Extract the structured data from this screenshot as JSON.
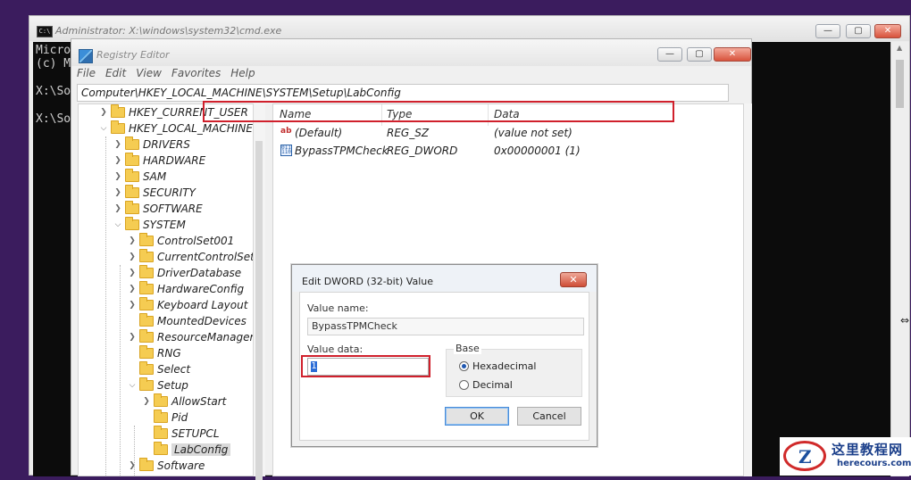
{
  "cmd": {
    "title": "Administrator: X:\\windows\\system32\\cmd.exe",
    "icon_text": "C:\\",
    "lines": [
      "Micro",
      "(c) M",
      "X:\\So",
      "X:\\So"
    ]
  },
  "regedit": {
    "title": "Registry Editor",
    "menu": [
      "File",
      "Edit",
      "View",
      "Favorites",
      "Help"
    ],
    "address": "Computer\\HKEY_LOCAL_MACHINE\\SYSTEM\\Setup\\LabConfig",
    "tree": {
      "hkcu": "HKEY_CURRENT_USER",
      "hklm": "HKEY_LOCAL_MACHINE",
      "drivers": "DRIVERS",
      "hardware": "HARDWARE",
      "sam": "SAM",
      "security": "SECURITY",
      "software": "SOFTWARE",
      "system": "SYSTEM",
      "controlset001": "ControlSet001",
      "currentcontrolset": "CurrentControlSet",
      "driverdatabase": "DriverDatabase",
      "hardwareconfig": "HardwareConfig",
      "keyboardlayout": "Keyboard Layout",
      "mounteddevices": "MountedDevices",
      "resourcemanager": "ResourceManager",
      "rng": "RNG",
      "select": "Select",
      "setup": "Setup",
      "allowstart": "AllowStart",
      "pid": "Pid",
      "setupcl": "SETUPCL",
      "labconfig": "LabConfig",
      "software2": "Software"
    },
    "list": {
      "headers": {
        "name": "Name",
        "type": "Type",
        "data": "Data"
      },
      "rows": [
        {
          "name": "(Default)",
          "type": "REG_SZ",
          "data": "(value not set)"
        },
        {
          "name": "BypassTPMCheck",
          "type": "REG_DWORD",
          "data": "0x00000001 (1)"
        }
      ]
    }
  },
  "dialog": {
    "title": "Edit DWORD (32-bit) Value",
    "value_name_label": "Value name:",
    "value_name": "BypassTPMCheck",
    "value_data_label": "Value data:",
    "value_data": "1",
    "base_label": "Base",
    "hex_label": "Hexadecimal",
    "dec_label": "Decimal",
    "selected_base": "Hexadecimal",
    "ok": "OK",
    "cancel": "Cancel"
  },
  "window_buttons": {
    "min": "—",
    "max": "▢",
    "close": "✕"
  },
  "watermark": {
    "cn": "这里教程网",
    "en": "herecours.com",
    "logo": "Z"
  },
  "colors": {
    "highlight": "#d0202c",
    "desktop": "#3b1c5e",
    "console": "#0c0c0c"
  }
}
